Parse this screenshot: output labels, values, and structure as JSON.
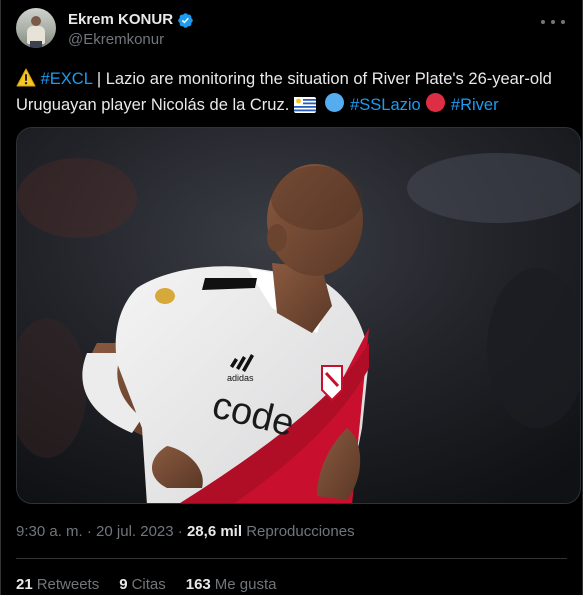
{
  "author": {
    "display_name": "Ekrem KONUR",
    "handle": "@Ekremkonur",
    "verified": true
  },
  "tweet": {
    "text_parts": [
      {
        "kind": "emoji",
        "value": "warning-emoji"
      },
      {
        "kind": "hashtag",
        "value": "#EXCL"
      },
      {
        "kind": "text",
        "value": " | Lazio are monitoring the situation of River Plate's 26-year-old Uruguayan player Nicolás de la Cruz. "
      },
      {
        "kind": "emoji",
        "value": "uruguay-flag-emoji"
      },
      {
        "kind": "emoji",
        "value": "light-blue-circle-emoji"
      },
      {
        "kind": "hashtag",
        "value": "#SSLazio"
      },
      {
        "kind": "emoji",
        "value": "red-circle-emoji"
      },
      {
        "kind": "hashtag",
        "value": "#River"
      }
    ],
    "hashtag_1": "#EXCL",
    "segment_1": " | Lazio are monitoring the situation of River Plate's 26-year-old Uruguayan player Nicolás de la Cruz. ",
    "hashtag_2": "#SSLazio",
    "hashtag_3": "#River"
  },
  "media": {
    "shirt_sponsor": "code",
    "kit_brand": "adidas"
  },
  "meta": {
    "time": "9:30 a. m.",
    "separator": "·",
    "date": "20 jul. 2023",
    "views_count": "28,6 mil",
    "views_label": "Reproducciones"
  },
  "stats": {
    "retweets_count": "21",
    "retweets_label": "Retweets",
    "quotes_count": "9",
    "quotes_label": "Citas",
    "likes_count": "163",
    "likes_label": "Me gusta"
  },
  "colors": {
    "background": "#000000",
    "text": "#e7e9ea",
    "secondary": "#71767b",
    "link": "#1d9bf0",
    "border": "#2f3336",
    "verified": "#1d9bf0"
  }
}
